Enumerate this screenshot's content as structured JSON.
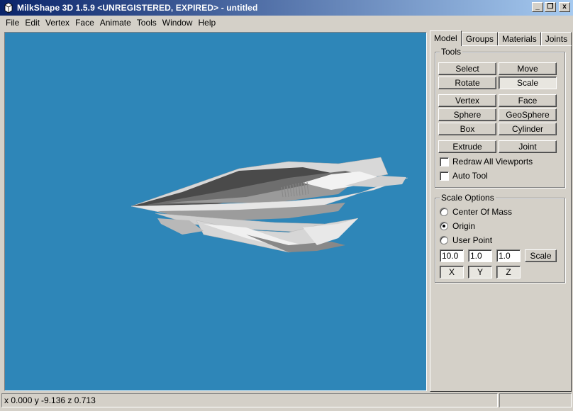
{
  "window": {
    "title": "MilkShape 3D 1.5.9 <UNREGISTERED, EXPIRED> - untitled",
    "minimize": "_",
    "maximize": "❐",
    "close": "x"
  },
  "menu": [
    "File",
    "Edit",
    "Vertex",
    "Face",
    "Animate",
    "Tools",
    "Window",
    "Help"
  ],
  "tabs": [
    "Model",
    "Groups",
    "Materials",
    "Joints"
  ],
  "tools": {
    "title": "Tools",
    "select": "Select",
    "move": "Move",
    "rotate": "Rotate",
    "scale": "Scale",
    "vertex": "Vertex",
    "face": "Face",
    "sphere": "Sphere",
    "geosphere": "GeoSphere",
    "box": "Box",
    "cylinder": "Cylinder",
    "extrude": "Extrude",
    "joint": "Joint",
    "redraw_all": "Redraw All Viewports",
    "auto_tool": "Auto Tool"
  },
  "scale_options": {
    "title": "Scale Options",
    "center_of_mass": "Center Of Mass",
    "origin": "Origin",
    "user_point": "User Point",
    "x_value": "10.0",
    "y_value": "1.0",
    "z_value": "1.0",
    "scale_button": "Scale",
    "x_button": "X",
    "y_button": "Y",
    "z_button": "Z"
  },
  "status": {
    "coords": "x 0.000 y -9.136 z 0.713"
  },
  "colors": {
    "viewport_bg": "#2e86b8",
    "title_start": "#0a246a",
    "title_end": "#a6caf0"
  }
}
